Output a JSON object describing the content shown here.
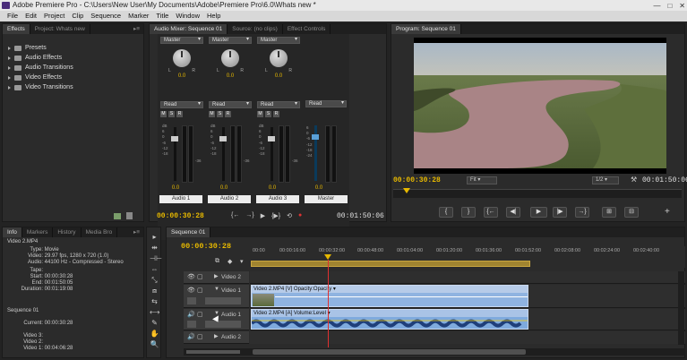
{
  "window": {
    "title": "Adobe Premiere Pro - C:\\Users\\New User\\My Documents\\Adobe\\Premiere Pro\\6.0\\Whats new *",
    "controls": [
      "—",
      "□",
      "✕"
    ]
  },
  "menu": [
    "File",
    "Edit",
    "Project",
    "Clip",
    "Sequence",
    "Marker",
    "Title",
    "Window",
    "Help"
  ],
  "effects_panel": {
    "tabs": [
      "Effects",
      "Project: Whats new"
    ],
    "items": [
      "Presets",
      "Audio Effects",
      "Audio Transitions",
      "Video Effects",
      "Video Transitions"
    ]
  },
  "mixer_panel": {
    "tabs": [
      "Audio Mixer: Sequence 01",
      "Source: (no clips)",
      "Effect Controls"
    ],
    "channels": [
      {
        "name": "Audio 1",
        "route": "Master",
        "auto": "Read",
        "value": "0.0",
        "fader": "0.0"
      },
      {
        "name": "Audio 2",
        "route": "Master",
        "auto": "Read",
        "value": "0.0",
        "fader": "0.0"
      },
      {
        "name": "Audio 3",
        "route": "Master",
        "auto": "Read",
        "value": "0.0",
        "fader": "0.0"
      },
      {
        "name": "Master",
        "route": "",
        "auto": "Read",
        "value": "",
        "fader": "0.0"
      }
    ],
    "knob_l": "L",
    "knob_r": "R",
    "msr": [
      "M",
      "S",
      "R"
    ],
    "db_scale": [
      "dB",
      "6",
      "0",
      "-6",
      "-12",
      "-18",
      "-24",
      "-30",
      "-36",
      "-∞"
    ],
    "meter_marks": [
      "-36",
      "-36",
      "-36"
    ],
    "timecode_left": "00:00:30:28",
    "timecode_right": "00:01:50:06"
  },
  "program_monitor": {
    "tab": "Program: Sequence 01",
    "timecode_current": "00:00:30:28",
    "fit": "Fit",
    "resolution": "1/2",
    "timecode_total": "00:01:50:06",
    "transport": [
      "{",
      "}",
      "{←",
      "◀|",
      "▶",
      "|▶",
      "→}",
      "⊞",
      "⊟"
    ],
    "add": "+"
  },
  "info_panel": {
    "tabs": [
      "Info",
      "Markers",
      "History",
      "Media Bro"
    ],
    "clip_name": "Video 2.MP4",
    "rows": [
      {
        "k": "Type:",
        "v": "Movie"
      },
      {
        "k": "Video:",
        "v": "29.97 fps, 1280 x 720 (1.0)"
      },
      {
        "k": "Audio:",
        "v": "44100 Hz - Compressed - Stereo"
      },
      {
        "k": "Tape:",
        "v": ""
      },
      {
        "k": "Start:",
        "v": "00:00:30:28"
      },
      {
        "k": "End:",
        "v": "00:01:50:05"
      },
      {
        "k": "Duration:",
        "v": "00:01:19:08"
      }
    ],
    "sequence_name": "Sequence 01",
    "seq_rows": [
      {
        "k": "Current:",
        "v": "00:00:30:28"
      },
      {
        "k": "Video 3:",
        "v": ""
      },
      {
        "k": "Video 2:",
        "v": ""
      },
      {
        "k": "Video 1:",
        "v": "00:04:06:28"
      }
    ]
  },
  "timeline": {
    "tab": "Sequence 01",
    "timecode": "00:00:30:28",
    "ruler": [
      "00:00",
      "00:00:16:00",
      "00:00:32:00",
      "00:00:48:00",
      "00:01:04:00",
      "00:01:20:00",
      "00:01:36:00",
      "00:01:52:00",
      "00:02:08:00",
      "00:02:24:00",
      "00:02:40:00"
    ],
    "tracks": [
      {
        "name": "Video 2",
        "kind": "video"
      },
      {
        "name": "Video 1",
        "kind": "video"
      },
      {
        "name": "Audio 1",
        "kind": "audio"
      },
      {
        "name": "Audio 2",
        "kind": "audio"
      }
    ],
    "clip_video": "Video 2.MP4 [V]  Opacity:Opacity ▾",
    "clip_audio": "Video 2.MP4 [A]  Volume:Level ▾"
  },
  "tools": [
    "▸",
    "⇹",
    "⊣⊢",
    "⇔",
    "⤡",
    "⧈",
    "⇆",
    "⟷",
    "✎",
    "✋",
    "🔍"
  ],
  "colors": {
    "timecode": "#e6b800",
    "clip_video": "#8fb3e0",
    "clip_audio": "#7faadd",
    "playhead": "#e03030"
  }
}
